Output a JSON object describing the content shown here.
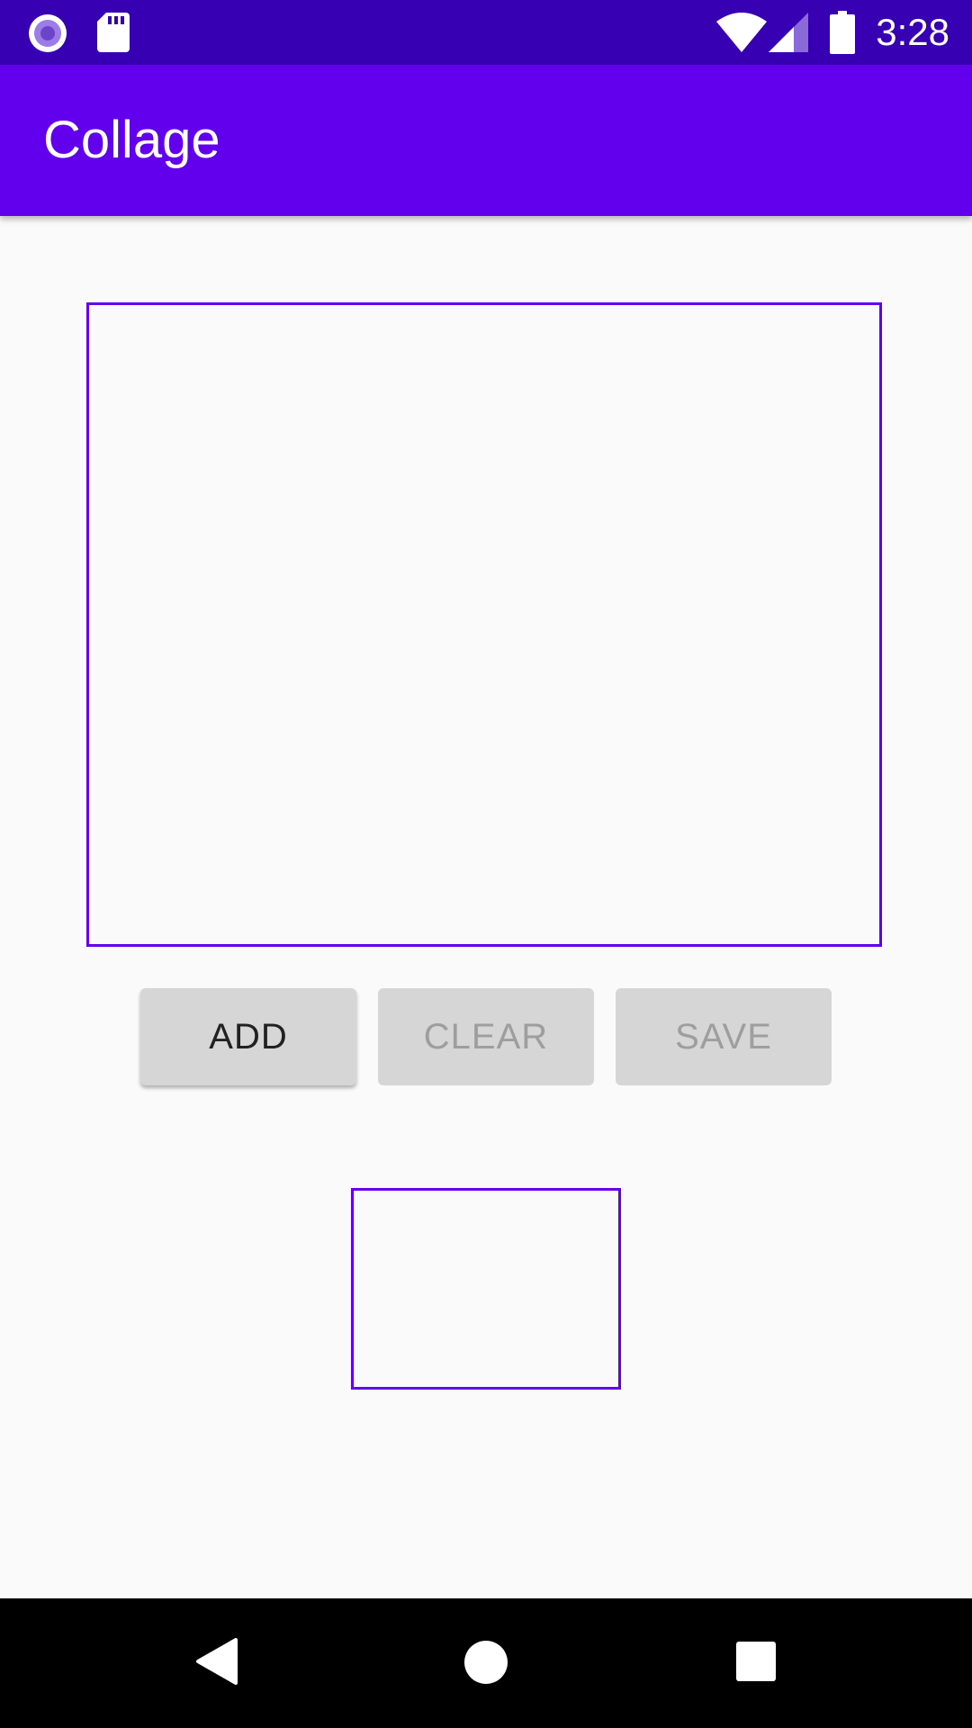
{
  "status_bar": {
    "time": "3:28",
    "left_icons": [
      "record-icon",
      "sd-card-icon"
    ],
    "right_icons": [
      "wifi-icon",
      "cell-signal-icon",
      "battery-icon"
    ]
  },
  "app_bar": {
    "title": "Collage"
  },
  "buttons": {
    "add_label": "ADD",
    "clear_label": "CLEAR",
    "save_label": "SAVE"
  },
  "nav_bar": {
    "icons": [
      "back-icon",
      "home-icon",
      "recents-icon"
    ]
  },
  "colors": {
    "status_bar": "#3700b3",
    "primary": "#6200ee",
    "background": "#fafafa",
    "button_bg": "#d6d6d6",
    "button_text_enabled": "#212121",
    "button_text_disabled": "#9e9e9e"
  }
}
